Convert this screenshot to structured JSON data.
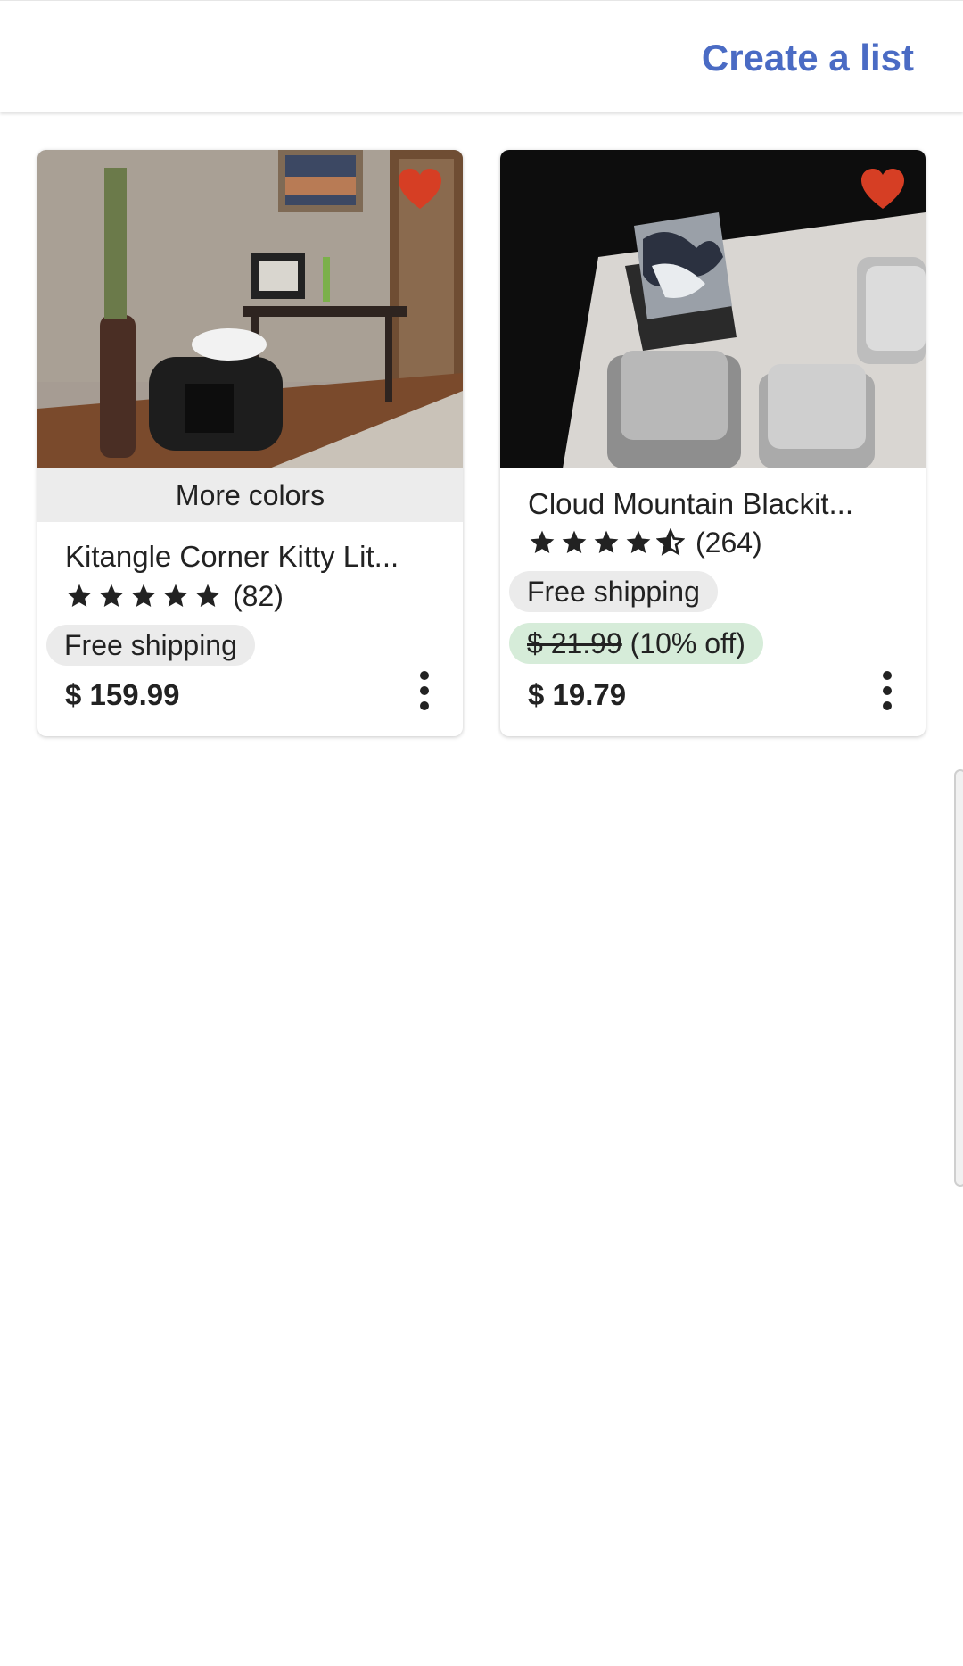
{
  "header": {
    "create_list_label": "Create a list"
  },
  "colors": {
    "accent": "#4a6bc4",
    "heart": "#d63e24",
    "discount_bg": "#d6ecd9",
    "pill_bg": "#ebebeb"
  },
  "listings": [
    {
      "title": "Kitangle Corner Kitty Lit...",
      "more_colors_label": "More colors",
      "rating": 5,
      "reviews": "(82)",
      "shipping": "Free shipping",
      "price": "$ 159.99",
      "favorited": true
    },
    {
      "title": "Cloud Mountain Blackit...",
      "rating": 4.5,
      "reviews": "(264)",
      "shipping": "Free shipping",
      "original_price": "$ 21.99",
      "discount": "(10% off)",
      "price": "$ 19.79",
      "favorited": true
    }
  ]
}
